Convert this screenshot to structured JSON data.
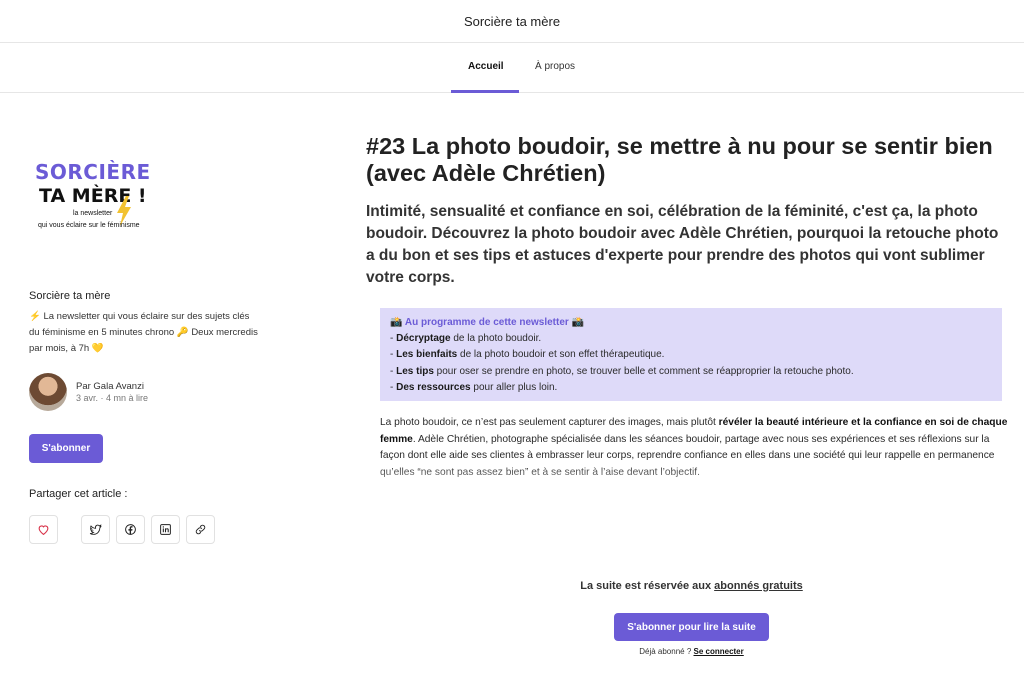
{
  "header": {
    "title": "Sorcière ta mère"
  },
  "nav": {
    "tabs": [
      {
        "label": "Accueil",
        "active": true
      },
      {
        "label": "À propos",
        "active": false
      }
    ]
  },
  "sidebar": {
    "logo": {
      "line1": "SORCIÈRE",
      "line2": "TA MÈRE !",
      "line3": "la newsletter",
      "line4": "qui vous éclaire sur le féminisme"
    },
    "name": "Sorcière ta mère",
    "description": "⚡ La newsletter qui vous éclaire sur des sujets clés du féminisme en 5 minutes chrono 🔑 Deux mercredis par mois, à 7h 💛",
    "author": "Par Gala Avanzi",
    "meta": "3 avr. · 4 mn à lire",
    "subscribe_label": "S'abonner",
    "share_label": "Partager cet article :",
    "share_icons": [
      "heart-icon",
      "twitter-icon",
      "facebook-icon",
      "linkedin-icon",
      "link-icon"
    ]
  },
  "article": {
    "title": "#23 La photo boudoir, se mettre à nu pour se sentir bien (avec Adèle Chrétien)",
    "subtitle": "Intimité, sensualité et confiance en soi, célébration de la féminité, c'est ça, la photo boudoir. Découvrez la photo boudoir avec Adèle Chrétien, pourquoi la retouche photo a du bon et ses tips et astuces d'experte pour prendre des photos qui vont sublimer votre corps.",
    "program": {
      "title": "📸 Au programme de cette newsletter 📸",
      "items": [
        {
          "bold": "Décryptage",
          "rest": " de la photo boudoir."
        },
        {
          "bold": "Les bienfaits",
          "rest": " de la photo boudoir et son effet thérapeutique."
        },
        {
          "bold": "Les tips",
          "rest": " pour oser se prendre en photo, se trouver belle et comment se réapproprier la retouche photo."
        },
        {
          "bold": "Des ressources",
          "rest": " pour aller plus loin."
        }
      ]
    },
    "body": {
      "part1": "La photo boudoir, ce n’est pas seulement capturer des images, mais plutôt ",
      "bold": "révéler la beauté intérieure et la confiance en soi de chaque femme",
      "part2": ". Adèle Chrétien, photographe spécialisée dans les séances boudoir, partage avec nous ses expériences et ses réflexions sur la façon dont elle aide ses clientes à embrasser leur corps, reprendre confiance en elles dans une société qui leur rappelle en permanence qu’elles “ne sont pas assez bien” et à se sentir à l’aise devant l’objectif."
    }
  },
  "paywall": {
    "text": "La suite est réservée aux ",
    "link": "abonnés gratuits",
    "button": "S'abonner pour lire la suite",
    "already": "Déjà abonné ? ",
    "login": "Se connecter"
  },
  "colors": {
    "accent": "#6b5bd6",
    "program_bg": "#dedaf9"
  }
}
